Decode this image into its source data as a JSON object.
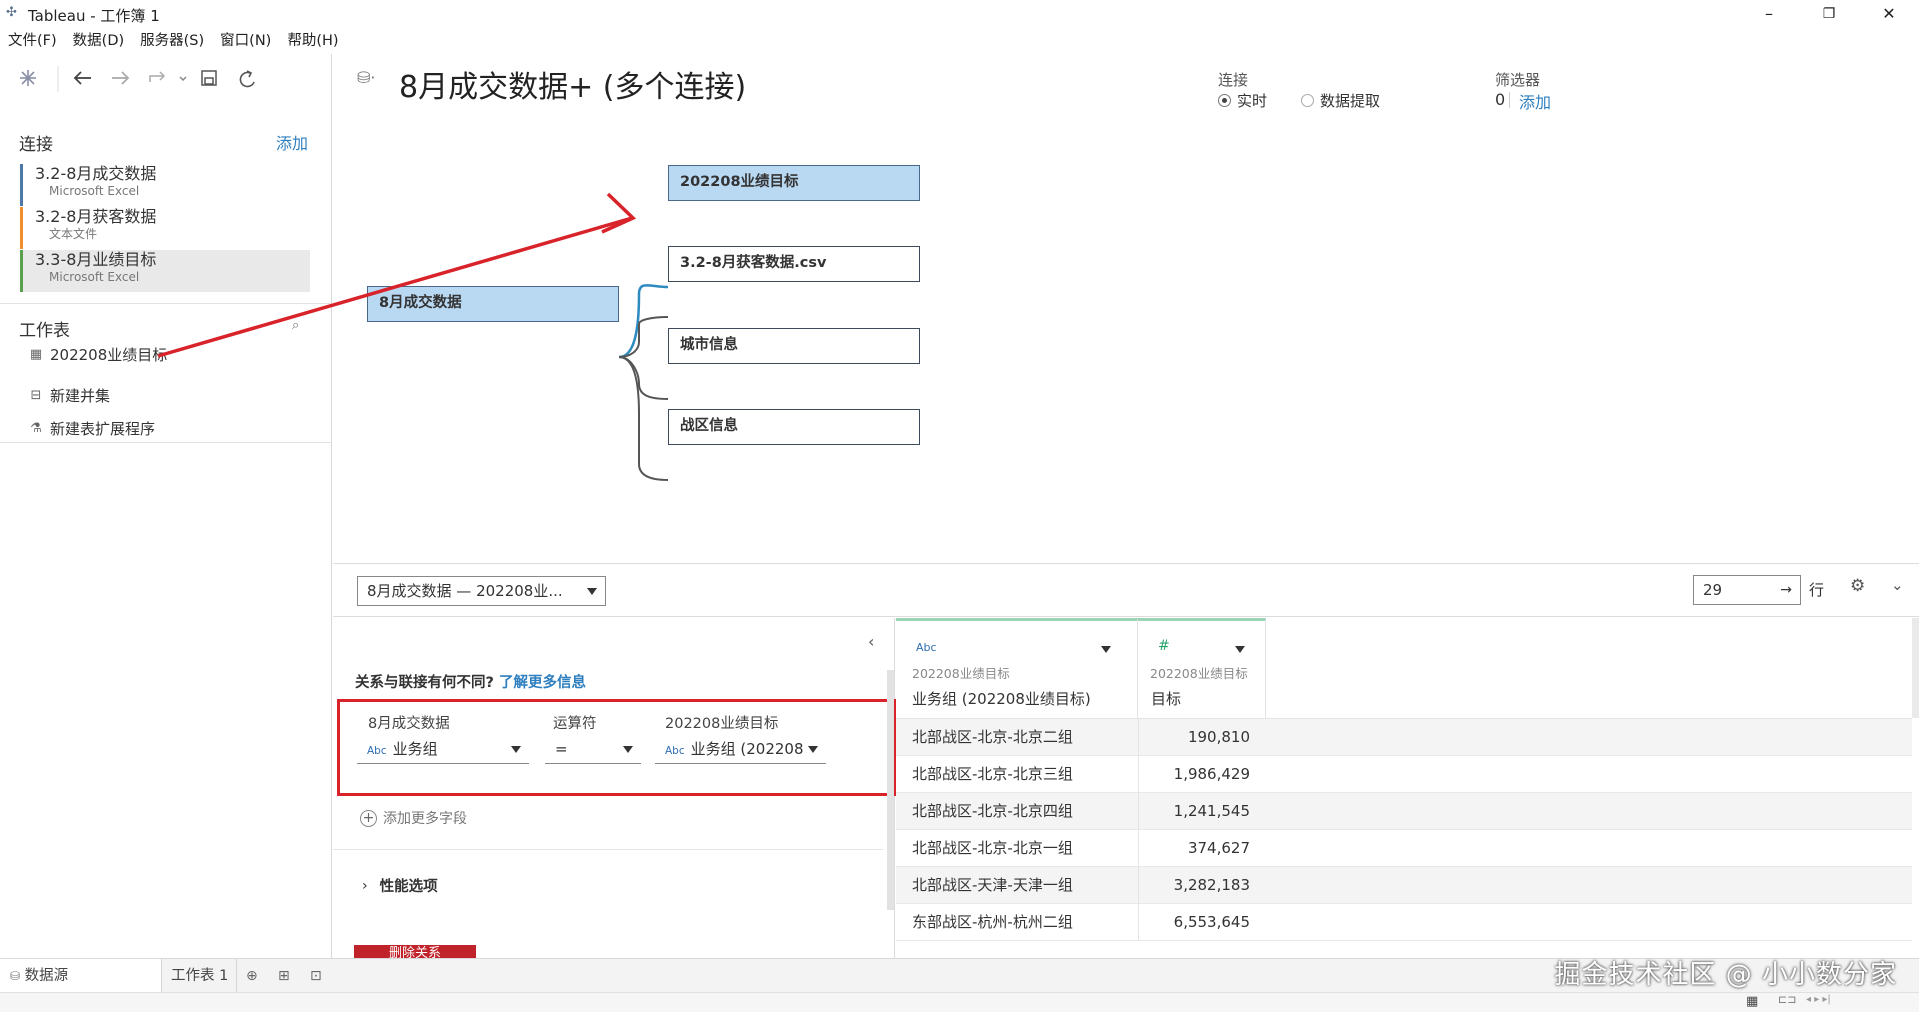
{
  "window": {
    "title": "Tableau - 工作簿 1",
    "minimize": "–",
    "restore": "❐",
    "close": "✕"
  },
  "menu": [
    "文件(F)",
    "数据(D)",
    "服务器(S)",
    "窗口(N)",
    "帮助(H)"
  ],
  "left": {
    "connections_title": "连接",
    "add_label": "添加",
    "connections": [
      {
        "name": "3.2-8月成交数据",
        "type": "Microsoft Excel",
        "color": "#4e79a7"
      },
      {
        "name": "3.2-8月获客数据",
        "type": "文本文件",
        "color": "#f28e2b"
      },
      {
        "name": "3.3-8月业绩目标",
        "type": "Microsoft Excel",
        "color": "#59a14f"
      }
    ],
    "sheets_title": "工作表",
    "sheets": [
      {
        "name": "202208业绩目标"
      }
    ],
    "new_union": "新建并集",
    "new_extension": "新建表扩展程序"
  },
  "canvas": {
    "title": "8月成交数据+ (多个连接)",
    "connection_label": "连接",
    "live_label": "实时",
    "extract_label": "数据提取",
    "filters_label": "筛选器",
    "filters_count": "0",
    "filters_add": "添加",
    "nodes": {
      "root": "8月成交数据",
      "children": [
        "202208业绩目标",
        "3.2-8月获客数据.csv",
        "城市信息",
        "战区信息"
      ]
    }
  },
  "gridbar": {
    "relation_select": "8月成交数据 — 202208业...",
    "rows_value": "29",
    "rows_label": "行"
  },
  "join": {
    "question": "关系与联接有何不同?",
    "learn_more": "了解更多信息",
    "left_table": "8月成交数据",
    "operator_label": "运算符",
    "right_table": "202208业绩目标",
    "left_field": "业务组",
    "operator": "=",
    "right_field": "业务组 (202208",
    "add_more": "添加更多字段",
    "perf": "性能选项",
    "delete": "删除关系",
    "abc": "Abc"
  },
  "grid": {
    "columns": [
      {
        "type": "Abc",
        "source": "202208业绩目标",
        "name": "业务组 (202208业绩目标)"
      },
      {
        "type": "#",
        "source": "202208业绩目标",
        "name": "目标"
      }
    ],
    "rows": [
      [
        "北部战区-北京-北京二组",
        "190,810"
      ],
      [
        "北部战区-北京-北京三组",
        "1,986,429"
      ],
      [
        "北部战区-北京-北京四组",
        "1,241,545"
      ],
      [
        "北部战区-北京-北京一组",
        "374,627"
      ],
      [
        "北部战区-天津-天津一组",
        "3,282,183"
      ],
      [
        "东部战区-杭州-杭州二组",
        "6,553,645"
      ]
    ]
  },
  "status": {
    "datasource_tab": "数据源",
    "sheet_tab": "工作表 1"
  },
  "watermark": "掘金技术社区 @ 小小数分家"
}
